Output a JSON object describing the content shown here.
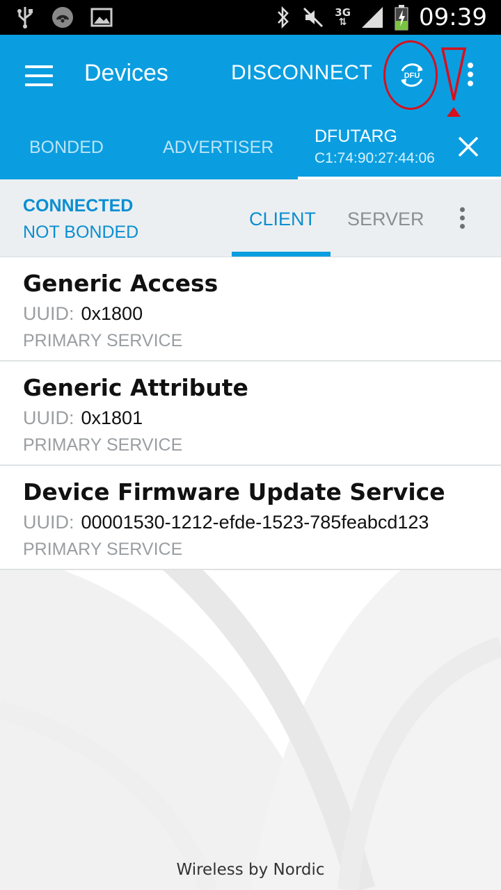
{
  "status_bar": {
    "icons_left": [
      "usb-icon",
      "hotspot-icon",
      "image-icon"
    ],
    "icons_right": [
      "bluetooth-icon",
      "mute-icon",
      "network-3g-icon",
      "signal-icon",
      "battery-charging-icon"
    ],
    "network": "3G",
    "time": "09:39"
  },
  "app_bar": {
    "title": "Devices",
    "disconnect_label": "DISCONNECT",
    "dfu_icon_label": "DFU",
    "tabs": [
      {
        "label": "BONDED"
      },
      {
        "label": "ADVERTISER"
      }
    ],
    "active_device": {
      "name": "DFUTARG",
      "address": "C1:74:90:27:44:06"
    }
  },
  "connection": {
    "state": "CONNECTED",
    "bond_state": "NOT BONDED",
    "tabs": [
      {
        "label": "CLIENT",
        "active": true
      },
      {
        "label": "SERVER",
        "active": false
      }
    ]
  },
  "services": [
    {
      "name": "Generic Access",
      "uuid_label": "UUID:",
      "uuid": "0x1800",
      "type": "PRIMARY SERVICE"
    },
    {
      "name": "Generic Attribute",
      "uuid_label": "UUID:",
      "uuid": "0x1801",
      "type": "PRIMARY SERVICE"
    },
    {
      "name": "Device Firmware Update Service",
      "uuid_label": "UUID:",
      "uuid": "00001530-1212-efde-1523-785feabcd123",
      "type": "PRIMARY SERVICE"
    }
  ],
  "footer": "Wireless by Nordic",
  "colors": {
    "primary": "#0a9ee0",
    "accent_text": "#0a8ed2",
    "annotation": "#d6101d"
  }
}
